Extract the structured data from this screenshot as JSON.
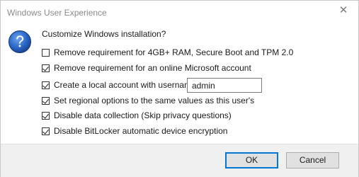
{
  "window": {
    "title": "Windows User Experience",
    "close_glyph": "✕"
  },
  "dialog": {
    "icon": "question-icon",
    "heading": "Customize Windows installation?",
    "options": [
      {
        "label": "Remove requirement for 4GB+ RAM, Secure Boot and TPM 2.0",
        "checked": false
      },
      {
        "label": "Remove requirement for an online Microsoft account",
        "checked": true
      },
      {
        "label": "Create a local account with username:",
        "checked": true
      },
      {
        "label": "Set regional options to the same values as this user's",
        "checked": true
      },
      {
        "label": "Disable data collection (Skip privacy questions)",
        "checked": true
      },
      {
        "label": "Disable BitLocker automatic device encryption",
        "checked": true
      }
    ],
    "username_value": "admin"
  },
  "footer": {
    "ok_label": "OK",
    "cancel_label": "Cancel"
  },
  "colors": {
    "accent": "#0078d7",
    "icon_blue": "#1f5fbf",
    "footer_bg": "#f0f0f0"
  }
}
